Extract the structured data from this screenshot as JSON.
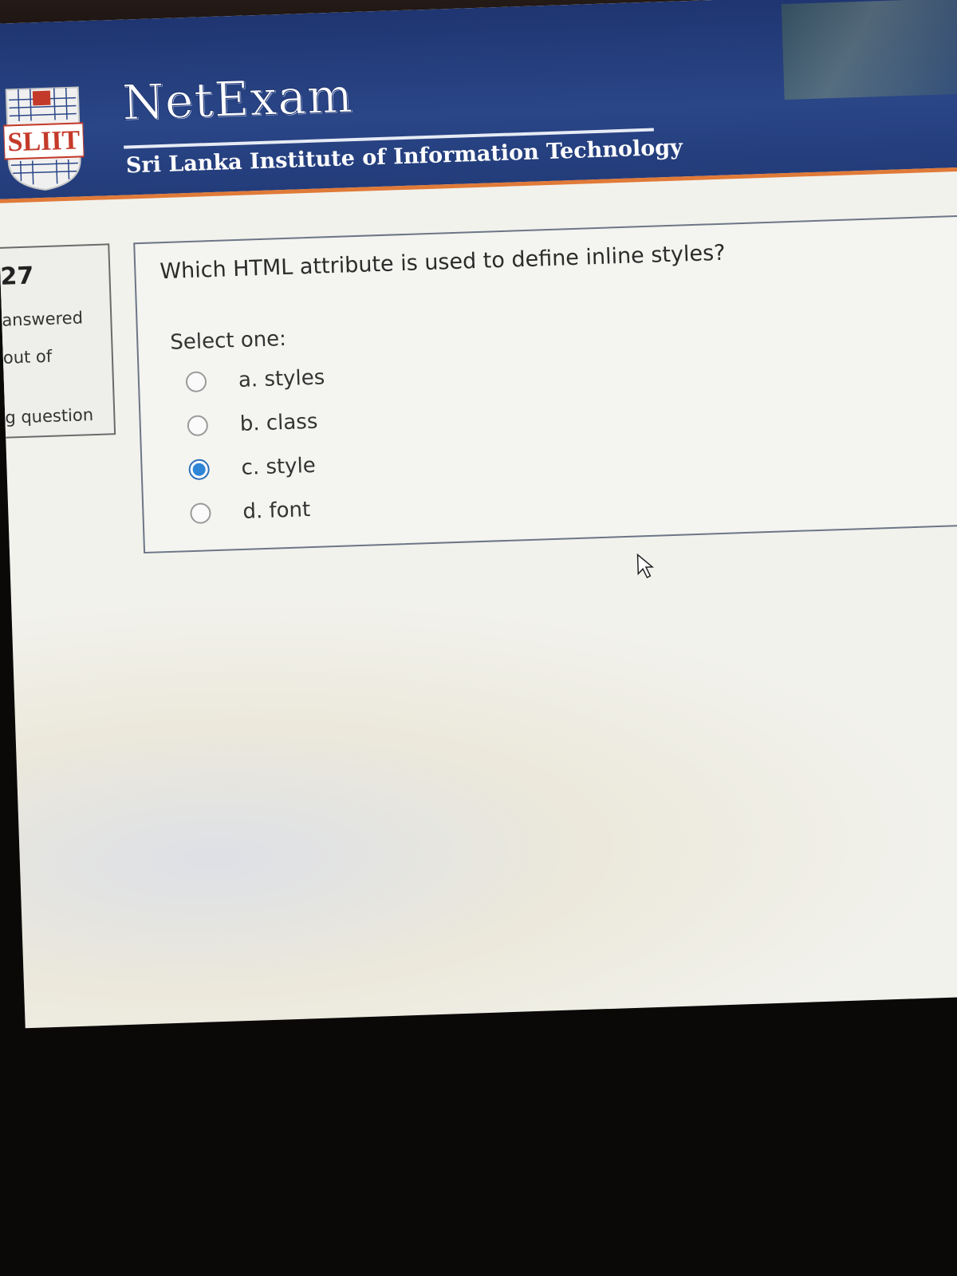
{
  "header": {
    "logo_text": "SLIIT",
    "brand_title": "NetExam",
    "brand_subtitle": "Sri Lanka Institute of Information Technology"
  },
  "nav": {
    "question_number": "27",
    "status": "answered",
    "marks": "out of",
    "flag": "g question"
  },
  "question": {
    "text": "Which HTML attribute is used to define inline styles?",
    "prompt": "Select one:",
    "options": [
      {
        "label": "a. styles",
        "selected": false
      },
      {
        "label": "b. class",
        "selected": false
      },
      {
        "label": "c. style",
        "selected": true
      },
      {
        "label": "d. font",
        "selected": false
      }
    ]
  },
  "colors": {
    "header_blue": "#2a4687",
    "accent_orange": "#e07a38",
    "radio_selected": "#2f86d6"
  }
}
